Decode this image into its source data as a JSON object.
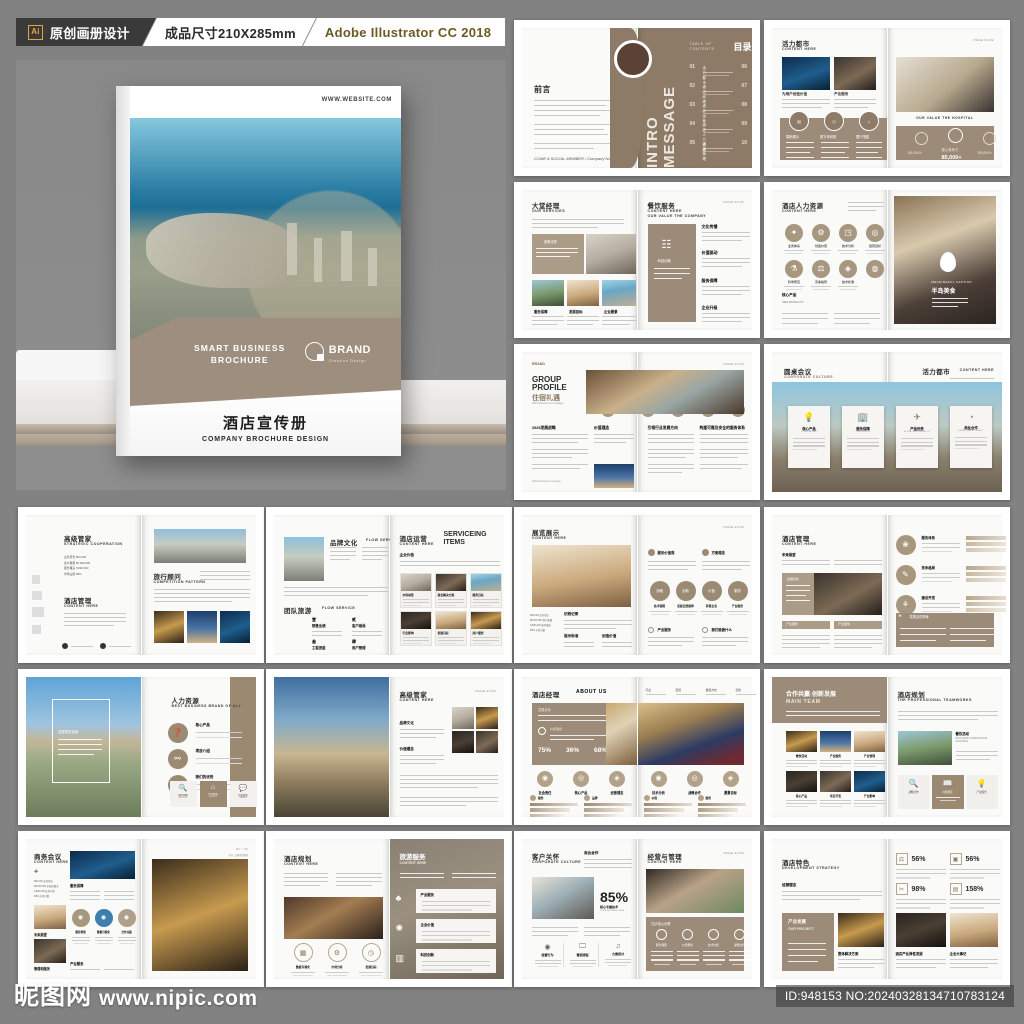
{
  "header": {
    "ai_badge": "Ai",
    "tag_origin": "原创画册设计",
    "tag_size": "成品尺寸210X285mm",
    "tag_software": "Adobe Illustrator CC 2018"
  },
  "cover": {
    "website": "WWW.WEBSITE.COM",
    "band_line1": "SMART BUSINESS",
    "band_line2": "BROCHURE",
    "brand_name": "BRAND",
    "brand_sub": "Creative Design",
    "title_cn": "酒店宣传册",
    "title_en": "COMPANY BROCHURE DESIGN"
  },
  "footer": {
    "watermark_cn": "昵图网",
    "watermark_url": "www.nipic.com",
    "id_text": "ID:948153 NO:20240328134710783124"
  },
  "spreads": [
    {
      "id": "toc",
      "left": {
        "title_cn": "前言",
        "vertical_en": "INTRO MESSAGE",
        "signature": "COME A SOCIAL MEMBER / Company Name"
      },
      "right": {
        "label_en": "TABLE OF CONTENTS",
        "label_cn": "目录",
        "items": [
          {
            "no": "01",
            "label": "活力都市"
          },
          {
            "no": "02",
            "label": "酒店经理"
          },
          {
            "no": "03",
            "label": "酒店运营"
          },
          {
            "no": "04",
            "label": "酒店人力资源"
          },
          {
            "no": "05",
            "label": "酒店管理"
          },
          {
            "no": "06",
            "label": "大堂经理"
          },
          {
            "no": "07",
            "label": "餐饮服务"
          },
          {
            "no": "08",
            "label": "展厅展示"
          },
          {
            "no": "09",
            "label": "酒店规划"
          },
          {
            "no": "10",
            "label": "酒店特色"
          }
        ]
      }
    },
    {
      "id": "vital-city",
      "left": {
        "title_cn": "活力都市",
        "title_en": "CONTENT HERE",
        "captions": [
          "为用户创造价值",
          "产业服务"
        ],
        "icon_labels": [
          "展销展示",
          "数字化转型",
          "展厅搭建"
        ]
      },
      "right": {
        "page_no": "PAGE 01/02",
        "caption_en": "OUR VALUE THE HOSPITAL",
        "stats": [
          {
            "value": "30,000+",
            "label": ""
          },
          {
            "value": "85,000+",
            "label": "核心竞争力"
          },
          {
            "value": "30,000+",
            "label": ""
          }
        ]
      }
    },
    {
      "id": "lobby-manager",
      "left": {
        "title_cn": "大堂经理",
        "title_en": "OUR SERVICES",
        "card_label": "政策法规",
        "captions": [
          "服务保障",
          "发展目标",
          "企业愿景"
        ]
      },
      "right": {
        "title_cn": "餐饮服务",
        "title_en": "CONTENT HERE",
        "title_en2": "OUR VALUE THE COMPANY",
        "page_no": "PAGE 01/02",
        "panel_label": "科技创新",
        "sections": [
          "文化传播",
          "价值驱动",
          "服务保障",
          "企业升级"
        ]
      }
    },
    {
      "id": "hr-resource",
      "left": {
        "title_cn": "酒店人力资源",
        "title_en": "CONTENT HERE",
        "icons": [
          "业务体系",
          "创造价值",
          "技术分析",
          "经营目标",
          "科学研究",
          "竞争格局",
          "技术标准"
        ],
        "footer_cn": "核心产品",
        "footer_en": "NEW PRODUCTS"
      },
      "right": {
        "overlay_cn": "半岛美食",
        "overlay_en": "MEANINGFUL CAPTION"
      }
    },
    {
      "id": "group-profile",
      "left": {
        "brand": "BRAND",
        "title_en1": "GROUP",
        "title_en2": "PROFILE",
        "title_cn": "住宿礼遇",
        "title_sub": "2025 development strategy",
        "section1": "2025发展战略",
        "section2": "价值理念",
        "footer": "2025 development strategy"
      },
      "right": {
        "page_no": "PAGE 01/02",
        "section1": "引领行业发展方向",
        "section2": "构建可靠及安全的服务体系"
      }
    },
    {
      "id": "round-table",
      "left": {
        "title_cn": "圆桌会议",
        "title_en": "CORPORATE CULTURE"
      },
      "right": {
        "title_cn": "活力都市",
        "title_en": "CONTENT HERE"
      },
      "cards": [
        {
          "cn": "核心产品",
          "en": "CORE VALUES"
        },
        {
          "cn": "服务保障",
          "en": "OUR MISSION"
        },
        {
          "cn": "产品优势",
          "en": "SOCIAL RESPONSIBILITY"
        },
        {
          "cn": "商业合作",
          "en": "ENVIRONMENT IMPACT"
        }
      ]
    },
    {
      "id": "butler",
      "left": {
        "title_cn": "高级管家",
        "title_en": "STRATEGIC COOPERATION",
        "stats": [
          "业务增长 800,000",
          "客户数量 80,000,000",
          "服务覆盖 5,800,000",
          "市场占额 98%"
        ],
        "title2_cn": "酒店管理",
        "title2_en": "CONTENT HERE"
      },
      "right": {
        "title_cn": "旅行顾问",
        "title_en": "COMPETITION PATTERN"
      }
    },
    {
      "id": "brand-culture",
      "left": {
        "title1_cn": "品牌文化",
        "title1_en": "FLOW SERVICE",
        "title2_cn": "团队旅游",
        "title2_en": "FLOW SERVICE",
        "items": [
          "销售业绩",
          "客户格局",
          "工程进度",
          "用户管理"
        ]
      },
      "right": {
        "title_cn": "酒店运营",
        "title_en": "CONTENT HERE",
        "title_big": "SERVICEING ITEMS",
        "sub_cn": "企业价值",
        "cards": [
          "市场前景",
          "商业解决方案",
          "服务目标",
          "行业影响",
          "发展目标",
          "用户服务"
        ]
      }
    },
    {
      "id": "exhibition",
      "left": {
        "title_cn": "展览展示",
        "title_en": "CONTENT HERE",
        "stats": [
          "800,000 业务增长",
          "88,000,000 客户数量",
          "5,800,000 服务覆盖",
          "98% 市场占额"
        ],
        "sections": [
          "识别记录",
          "展示标准",
          "创造价值"
        ]
      },
      "right": {
        "page_no": "PAGE 01/02",
        "tops": [
          "服务价值观",
          "方案理念"
        ],
        "circles": [
          "战略",
          "创新",
          "价值",
          "服务"
        ],
        "circle_labels": [
          "技术保障",
          "发展自然规律",
          "转售企业",
          "产业服务"
        ],
        "bottoms": [
          "产业服务",
          "我们能做什么"
        ]
      }
    },
    {
      "id": "hotel-mgmt",
      "left": {
        "title_cn": "酒店管理",
        "title_en": "CONTENT HERE",
        "sub_cn": "未来展望",
        "photo_label": "发展目标",
        "tags": [
          "产业服务",
          "产业服务"
        ]
      },
      "right": {
        "sections": [
          "服务体系",
          "竞争格局",
          "建设开发"
        ],
        "quote_label": "发展自然规律"
      }
    },
    {
      "id": "human-resource",
      "left": {
        "overlay_cn": "发展理念创新"
      },
      "right": {
        "title_cn": "人力资源",
        "title_en": "BEST BUSINESS BRAND OF ALL",
        "items": [
          "核心产品",
          "项目介绍",
          "我们的优势"
        ],
        "chips": [
          "服务保障 SERVICE",
          "企业愿景 MISSION",
          "价值理念 VALUES"
        ]
      }
    },
    {
      "id": "tower",
      "left": {},
      "right": {
        "title_cn": "高级管家",
        "title_en": "CONTENT HERE",
        "page_no": "PAGE 01/02",
        "sections": [
          "品牌文化",
          "价值理念"
        ]
      }
    },
    {
      "id": "about-us",
      "left": {
        "title_cn": "酒店经理",
        "title_en": "ABOUT US",
        "panel_label": "发展目标",
        "panel_label2": "价值理念",
        "percents": [
          "75%",
          "36%",
          "68%"
        ],
        "icon_labels": [
          "社会责任",
          "核心产品",
          "经营理念"
        ],
        "bar_labels": [
          "服务",
          "品牌"
        ]
      },
      "right": {
        "top_labels": [
          "行业",
          "经营",
          "发展方向",
          "创新"
        ],
        "icon_labels": [
          "技术分析",
          "战略合作",
          "愿景目标"
        ],
        "bar_labels": [
          "价值",
          "服务"
        ]
      }
    },
    {
      "id": "main-team",
      "left": {
        "title_cn": "合作共赢·创新发展",
        "title_en": "MAIN TEAM",
        "captures": [
          "餐饮活动",
          "产业服务",
          "产业管理",
          "核心产品",
          "项目开发",
          "产业影响"
        ]
      },
      "right": {
        "title_cn": "酒店规划",
        "title_en": "THE PROFESSIONAL TEAMWORKS",
        "photo_cn": "餐饮活动",
        "photo_en": "PACKAGING LOREM IPSUM AVAILABLE",
        "chips": [
          "战略合作",
          "价值理念",
          "产业服务"
        ]
      }
    },
    {
      "id": "biz-meeting",
      "left": {
        "title_cn": "商务会议",
        "title_en": "CONTENT HERE",
        "page_no": "01 / 02",
        "page_sub": "项目 / 品牌营销策略",
        "stats": [
          "800,000 业务增长",
          "88,000,000 全面的服务",
          "5,800,000 技术可见",
          "98% 市场占额"
        ],
        "section1": "服务保障",
        "section2": "未来展望",
        "section3": "管理和服务",
        "circles": [
          "服务增值",
          "数据可视化",
          "合作共赢"
        ],
        "section4": "产业服务"
      },
      "right": {}
    },
    {
      "id": "hotel-plan",
      "left": {
        "title_cn": "酒店规划",
        "title_en": "CONTENT HERE",
        "circles": [
          "数据可视化",
          "市场分析",
          "发展目标"
        ]
      },
      "right": {
        "title_cn": "旅游服务",
        "title_en": "CONTENT HERE",
        "cards": [
          "产业服务",
          "企业价值",
          "科技创新"
        ]
      }
    },
    {
      "id": "customer-care",
      "left": {
        "title_cn": "客户关怀",
        "title_en": "CORPORATE CULTURE",
        "tag": "商业合作",
        "percent": "85%",
        "percent_cn": "核心专属技术",
        "percent_en": "CORE TECHNOLOGIES",
        "icon_labels": [
          "经营行为",
          "营销流程",
          "方案研讨"
        ]
      },
      "right": {
        "title_cn": "经营与管理",
        "title_en": "CONTENT HERE",
        "page_no": "PAGE 01/02",
        "panel_label": "四大核心优势",
        "items": [
          "服务保障",
          "价值理念",
          "技术分析",
          "战略合作"
        ]
      }
    },
    {
      "id": "features",
      "left": {
        "title_cn": "酒店特色",
        "title_en": "DEVELOPMENT STRATEGY",
        "sub_cn": "经营理念",
        "project_cn": "产业发展",
        "project_en": "OUR PROJECT",
        "caption": "整体解决方案"
      },
      "right": {
        "stats": [
          "56%",
          "56%",
          "98%",
          "158%"
        ],
        "captions": [
          "酒店产业弹性发展",
          "企业大事记"
        ]
      }
    }
  ]
}
